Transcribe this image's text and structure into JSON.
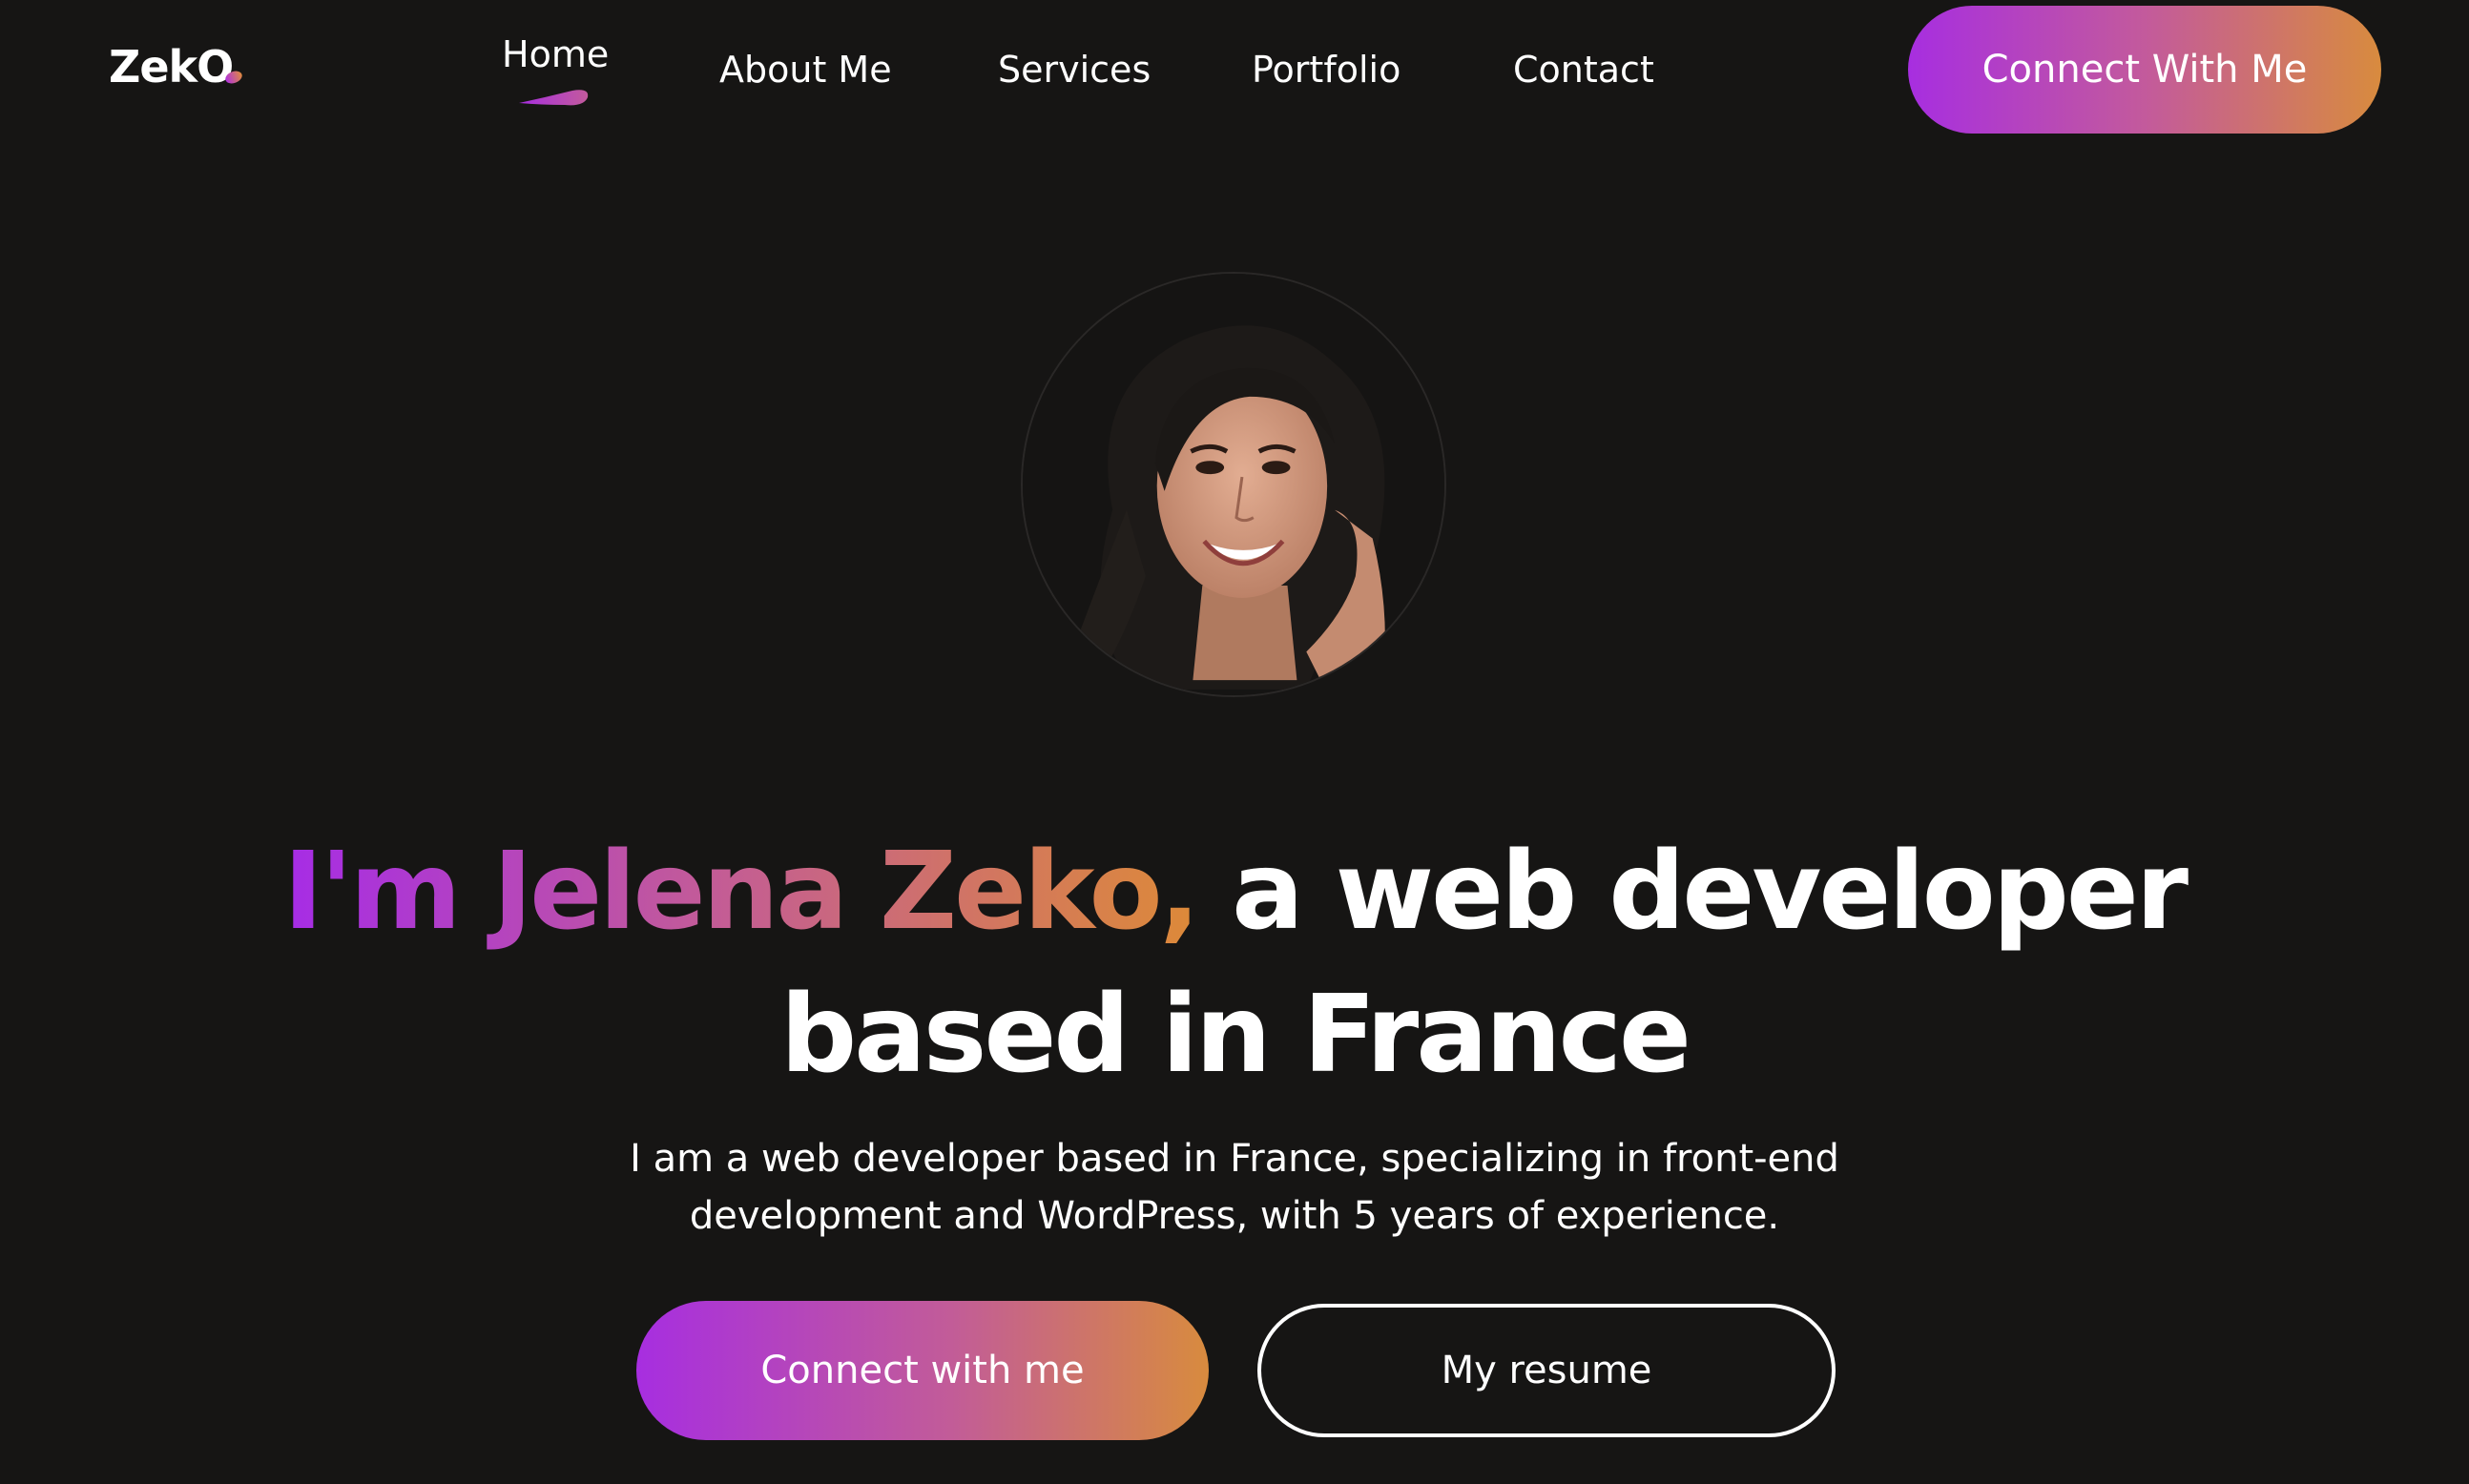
{
  "brand": {
    "logo_text": "ZekO"
  },
  "nav": {
    "items": [
      {
        "label": "Home",
        "active": true
      },
      {
        "label": "About Me",
        "active": false
      },
      {
        "label": "Services",
        "active": false
      },
      {
        "label": "Portfolio",
        "active": false
      },
      {
        "label": "Contact",
        "active": false
      }
    ],
    "cta_label": "Connect With Me"
  },
  "hero": {
    "avatar_icon": "profile-photo",
    "headline_highlight": "I'm Jelena Zeko,",
    "headline_rest_line1": "a web developer",
    "headline_line2": "based in France",
    "intro_line1": "I am a web developer based in France, specializing in front-end",
    "intro_line2": "development and WordPress, with 5 years of experience.",
    "primary_button": "Connect with me",
    "secondary_button": "My resume"
  },
  "colors": {
    "background": "#161514",
    "gradient_start": "#a72ee0",
    "gradient_end": "#d88b3e",
    "text": "#ffffff"
  }
}
